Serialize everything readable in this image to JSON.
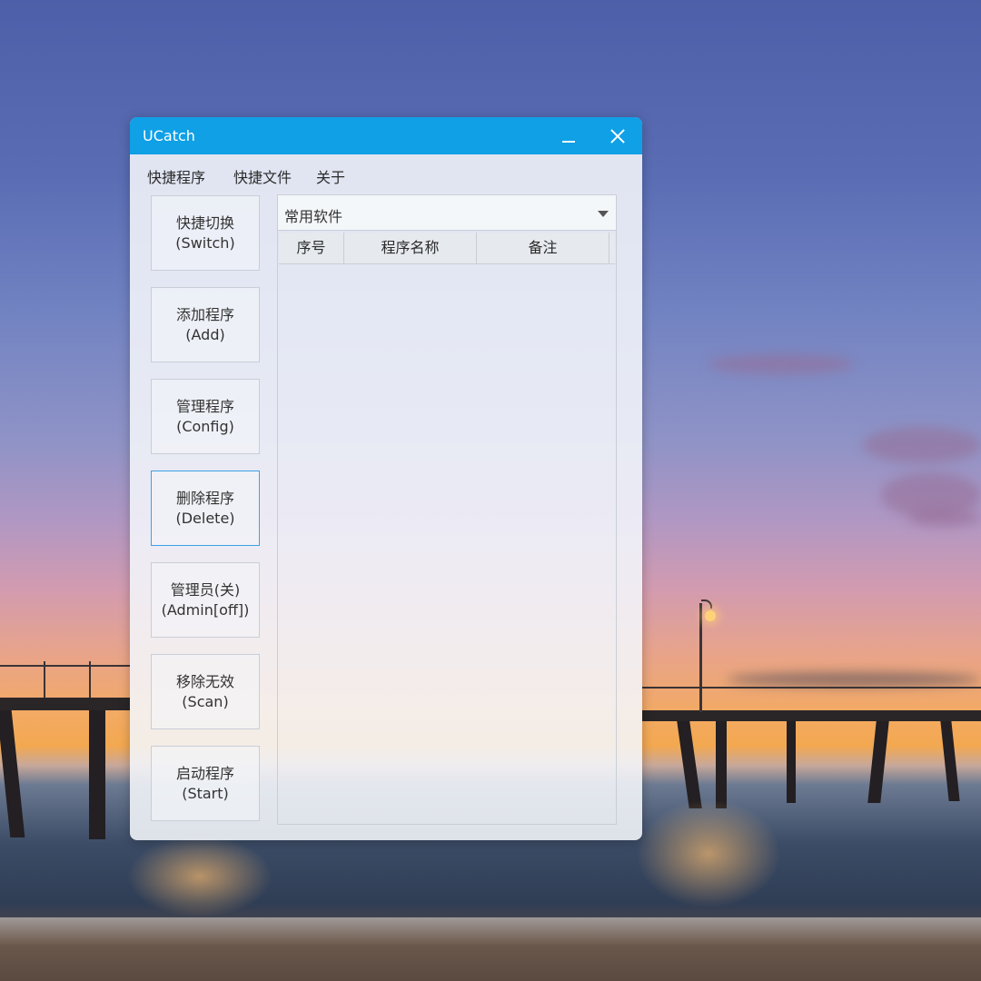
{
  "window": {
    "title": "UCatch"
  },
  "menu": [
    "快捷程序",
    "快捷文件",
    "关于"
  ],
  "sidebar": {
    "buttons": [
      {
        "cn": "快捷切换",
        "en": "(Switch)"
      },
      {
        "cn": "添加程序",
        "en": "(Add)"
      },
      {
        "cn": "管理程序",
        "en": "(Config)"
      },
      {
        "cn": "删除程序",
        "en": "(Delete)"
      },
      {
        "cn": "管理员(关)",
        "en": "(Admin[off])"
      },
      {
        "cn": "移除无效",
        "en": "(Scan)"
      },
      {
        "cn": "启动程序",
        "en": "(Start)"
      }
    ]
  },
  "category_select": {
    "value": "常用软件"
  },
  "table": {
    "columns": [
      "序号",
      "程序名称",
      "备注"
    ],
    "rows": []
  },
  "colors": {
    "titlebar": "#0fa0e6",
    "active_border": "#3da2e6"
  },
  "icons": {
    "minimize": "minimize-icon",
    "close": "close-icon",
    "dropdown": "chevron-down-icon"
  }
}
